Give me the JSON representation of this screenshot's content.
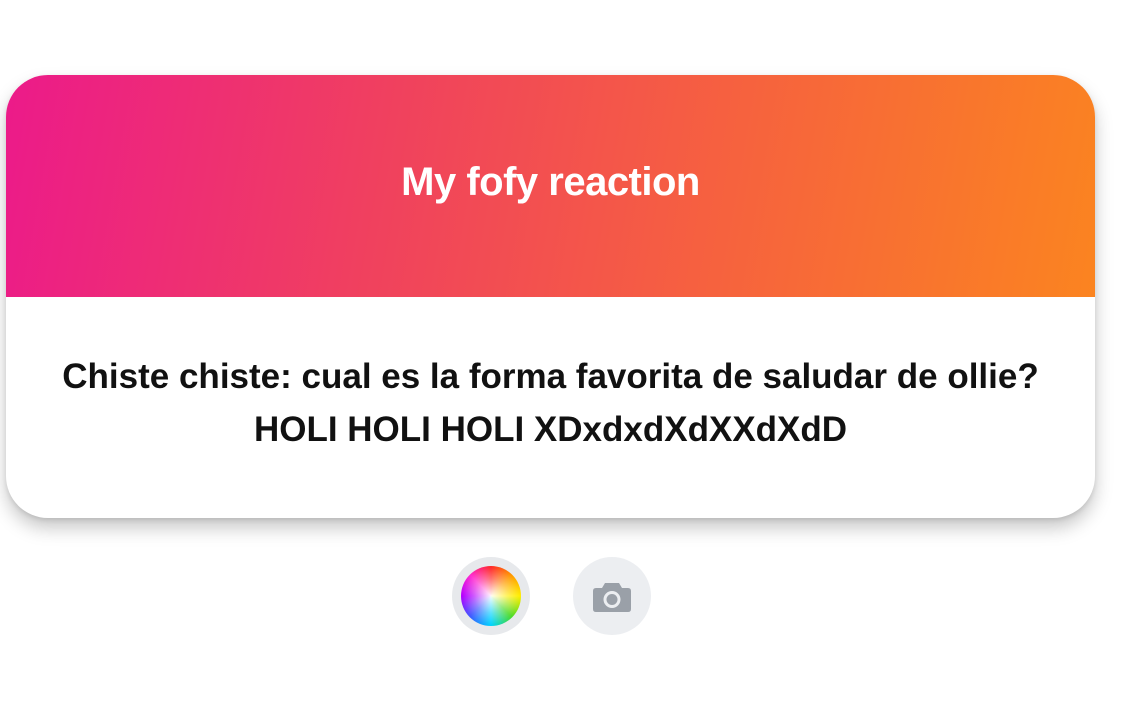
{
  "card": {
    "title": "My fofy reaction",
    "message": "Chiste chiste: cual es la forma favorita de saludar de ollie? HOLI HOLI HOLI XDxdxdXdXXdXdD",
    "gradient_colors": [
      "#ec1a8a",
      "#f0415e",
      "#f6613f",
      "#fb8420"
    ]
  },
  "controls": {
    "color_picker_icon": "color-wheel-icon",
    "camera_icon": "camera-icon"
  }
}
